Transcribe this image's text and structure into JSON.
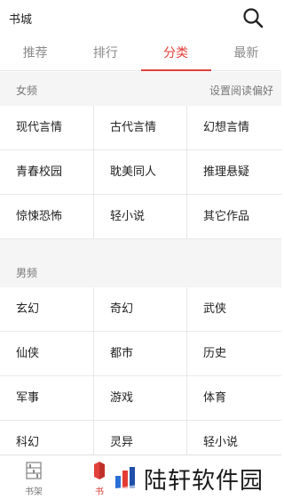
{
  "header": {
    "title": "书城",
    "search_icon": "search-icon"
  },
  "tabs": [
    {
      "label": "推荐",
      "active": false
    },
    {
      "label": "排行",
      "active": false
    },
    {
      "label": "分类",
      "active": true
    },
    {
      "label": "最新",
      "active": false
    }
  ],
  "female": {
    "label": "女频",
    "settings_link": "设置阅读偏好",
    "categories": [
      "现代言情",
      "古代言情",
      "幻想言情",
      "青春校园",
      "耽美同人",
      "推理悬疑",
      "惊悚恐怖",
      "轻小说",
      "其它作品"
    ]
  },
  "male": {
    "label": "男频",
    "categories": [
      "玄幻",
      "奇幻",
      "武侠",
      "仙侠",
      "都市",
      "历史",
      "军事",
      "游戏",
      "体育",
      "科幻",
      "灵异",
      "轻小说"
    ]
  },
  "bottom_nav": [
    {
      "label": "书架",
      "icon": "bookshelf-icon"
    },
    {
      "label": "书",
      "icon": "bookstore-icon"
    }
  ],
  "watermark": {
    "text": "陆轩软件园",
    "icon": "logo-icon"
  },
  "colors": {
    "accent": "#e1413a",
    "section_bg": "#f5f5f5"
  }
}
